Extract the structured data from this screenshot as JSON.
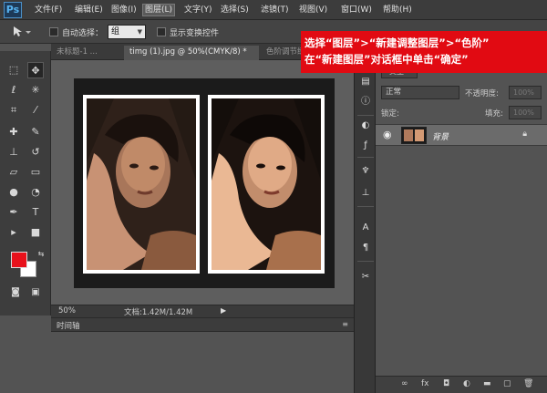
{
  "app": {
    "logo": "Ps"
  },
  "menu": [
    "文件(F)",
    "编辑(E)",
    "图像(I)",
    "图层(L)",
    "文字(Y)",
    "选择(S)",
    "滤镜(T)",
    "视图(V)",
    "窗口(W)",
    "帮助(H)"
  ],
  "options": {
    "auto_select_label": "自动选择：",
    "auto_select_value": "组",
    "show_transform_label": "显示变换控件"
  },
  "tabs": [
    {
      "label": "未标题-1 ..."
    },
    {
      "label": "timg (1).jpg @ 50%(CMYK/8) *"
    },
    {
      "label": "色阶调节练习"
    }
  ],
  "toolbox": {
    "tools": [
      "move-tool",
      "marquee-tool",
      "lasso-tool",
      "magic-wand-tool",
      "crop-tool",
      "eyedropper-tool",
      "healing-brush-tool",
      "brush-tool",
      "clone-stamp-tool",
      "history-brush-tool",
      "eraser-tool",
      "gradient-tool",
      "blur-tool",
      "dodge-tool",
      "pen-tool",
      "type-tool",
      "path-selection-tool",
      "rectangle-tool",
      "hand-tool",
      "zoom-tool"
    ],
    "foreground_color": "#e8111b",
    "background_color": "#ffffff"
  },
  "status": {
    "zoom": "50%",
    "doc_info": "文档:1.42M/1.42M"
  },
  "timeline": {
    "label": "时间轴"
  },
  "layers": {
    "filter": "类型",
    "blend_mode": "正常",
    "opacity_label": "不透明度:",
    "opacity_value": "100%",
    "lock_label": "锁定:",
    "fill_label": "填充:",
    "fill_value": "100%",
    "items": [
      {
        "name": "背景",
        "visible": true,
        "locked": true
      }
    ]
  },
  "instruction": {
    "line1": "选择“图层”>“新建调整图层”>“色阶”",
    "line2": "在“新建图层”对话框中单击“确定”"
  }
}
